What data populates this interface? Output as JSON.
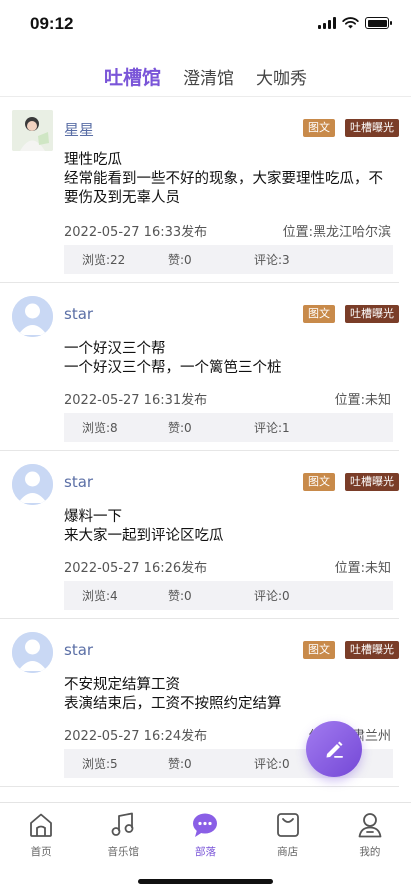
{
  "status_bar": {
    "time": "09:12"
  },
  "top_tabs": [
    {
      "label": "吐槽馆",
      "active": true
    },
    {
      "label": "澄清馆",
      "active": false
    },
    {
      "label": "大咖秀",
      "active": false
    }
  ],
  "posts": [
    {
      "username": "星星",
      "avatar": "photo",
      "badge_type": "图文",
      "badge_category": "吐槽曝光",
      "title": "理性吃瓜",
      "body": "经常能看到一些不好的现象，大家要理性吃瓜，不要伤及到无辜人员",
      "time": "2022-05-27 16:33发布",
      "location": "位置:黑龙江哈尔滨",
      "views": "浏览:22",
      "likes": "赞:0",
      "comments": "评论:3"
    },
    {
      "username": "star",
      "avatar": "default",
      "badge_type": "图文",
      "badge_category": "吐槽曝光",
      "title": "一个好汉三个帮",
      "body": "一个好汉三个帮，一个篱笆三个桩",
      "time": "2022-05-27 16:31发布",
      "location": "位置:未知",
      "views": "浏览:8",
      "likes": "赞:0",
      "comments": "评论:1"
    },
    {
      "username": "star",
      "avatar": "default",
      "badge_type": "图文",
      "badge_category": "吐槽曝光",
      "title": "爆料一下",
      "body": "来大家一起到评论区吃瓜",
      "time": "2022-05-27 16:26发布",
      "location": "位置:未知",
      "views": "浏览:4",
      "likes": "赞:0",
      "comments": "评论:0"
    },
    {
      "username": "star",
      "avatar": "default",
      "badge_type": "图文",
      "badge_category": "吐槽曝光",
      "title": "不安规定结算工资",
      "body": "表演结束后，工资不按照约定结算",
      "time": "2022-05-27 16:24发布",
      "location": "位置:甘肃兰州",
      "views": "浏览:5",
      "likes": "赞:0",
      "comments": "评论:0"
    }
  ],
  "fab": {
    "icon": "edit-icon"
  },
  "bottom_nav": [
    {
      "label": "首页",
      "icon": "home-icon",
      "active": false
    },
    {
      "label": "音乐馆",
      "icon": "music-icon",
      "active": false
    },
    {
      "label": "部落",
      "icon": "chat-bubble-icon",
      "active": true
    },
    {
      "label": "商店",
      "icon": "bag-icon",
      "active": false
    },
    {
      "label": "我的",
      "icon": "user-icon",
      "active": false
    }
  ],
  "colors": {
    "accent": "#7a55d8",
    "badge_type": "#c88a4a",
    "badge_category": "#7a3d28",
    "username": "#5b6fa6"
  }
}
